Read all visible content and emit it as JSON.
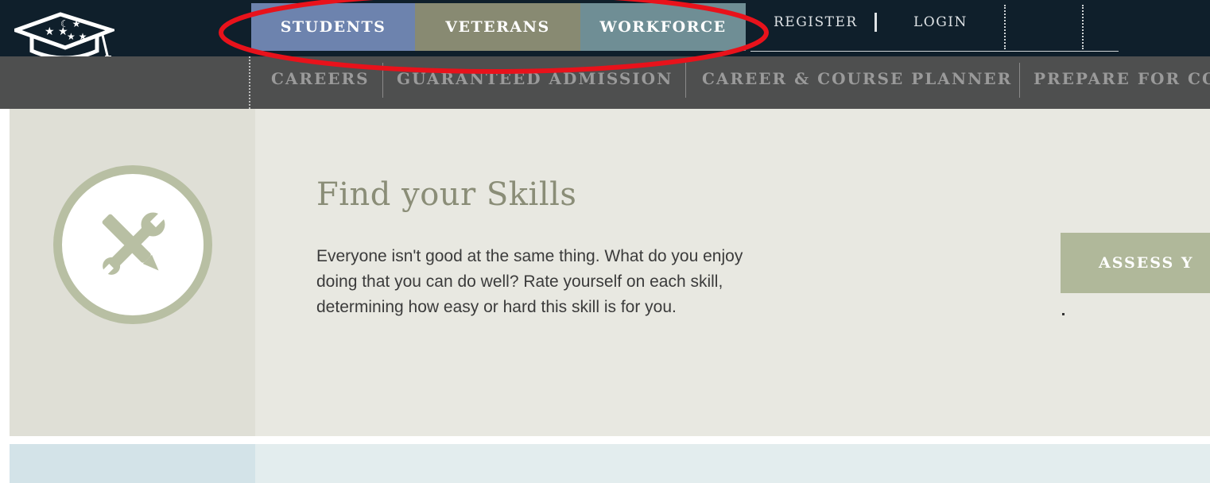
{
  "header": {
    "user_tabs": [
      {
        "label": "STUDENTS",
        "color": "#6d83ae"
      },
      {
        "label": "VETERANS",
        "color": "#888a72"
      },
      {
        "label": "WORKFORCE",
        "color": "#6f8e95"
      }
    ],
    "register_label": "REGISTER",
    "login_label": "LOGIN"
  },
  "subnav": {
    "items": [
      {
        "label": "CAREERS"
      },
      {
        "label": "GUARANTEED ADMISSION"
      },
      {
        "label": "CAREER & COURSE PLANNER"
      },
      {
        "label": "PREPARE FOR CO"
      }
    ]
  },
  "feature": {
    "icon": "wrench-pencil-icon",
    "title": "Find your Skills",
    "description": "Everyone isn't good at the same thing. What do you enjoy doing that you can do well? Rate yourself on each skill, determining how easy or hard this skill is for you.",
    "button_label": "ASSESS Y",
    "extra_text": "."
  },
  "annotation": {
    "color": "#e8121b",
    "shape": "ellipse"
  },
  "colors": {
    "top_bar": "#0f1f2b",
    "sub_bar": "#4e4f4f",
    "feature_bg": "#e8e8e1",
    "accent_green": "#b0b89a"
  }
}
